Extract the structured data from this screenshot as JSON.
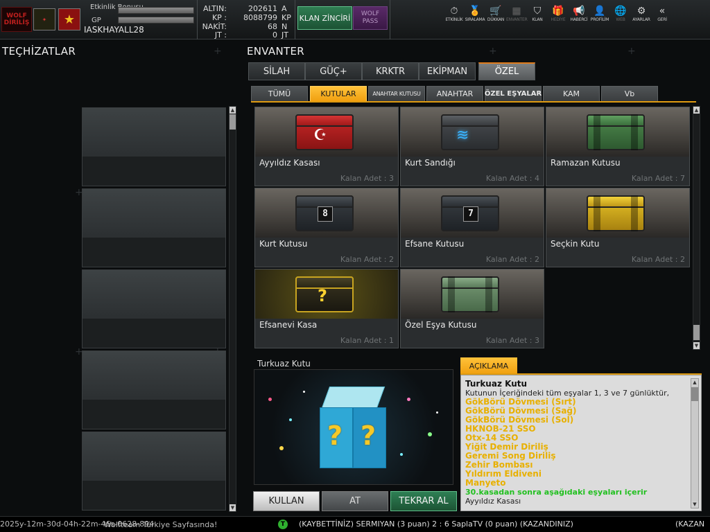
{
  "topbar": {
    "logo_text": "WOLF DİRİLİŞ",
    "event_bonus_label": "Etkinlik Bonusu",
    "gp_label": "GP",
    "username": "IASKHAYALL28",
    "currencies": [
      {
        "label": "ALTIN:",
        "value": "202611",
        "unit": "A"
      },
      {
        "label": "KP :",
        "value": "8088799",
        "unit": "KP"
      },
      {
        "label": "NAKİT:",
        "value": "68",
        "unit": "N"
      },
      {
        "label": "JT :",
        "value": "0",
        "unit": "JT"
      }
    ],
    "klan_button": "KLAN ZİNCİRİ",
    "wolf_pass": "WOLF PASS",
    "nav": [
      {
        "label": "ETKİNLİK",
        "icon": "stopwatch-icon",
        "glyph": "⏱"
      },
      {
        "label": "SIRALAMA",
        "icon": "medal-icon",
        "glyph": "🏅"
      },
      {
        "label": "DÜKKAN",
        "icon": "cart-icon",
        "glyph": "🛒"
      },
      {
        "label": "ENVANTER",
        "icon": "inventory-icon",
        "glyph": "▦"
      },
      {
        "label": "KLAN",
        "icon": "shield-icon",
        "glyph": "⛉"
      },
      {
        "label": "HEDİYE",
        "icon": "gift-icon",
        "glyph": "🎁"
      },
      {
        "label": "HABERCİ",
        "icon": "megaphone-icon",
        "glyph": "📢"
      },
      {
        "label": "PROFİLİM",
        "icon": "profile-icon",
        "glyph": "👤"
      },
      {
        "label": "WEB",
        "icon": "globe-icon",
        "glyph": "🌐"
      },
      {
        "label": "AYARLAR",
        "icon": "gear-icon",
        "glyph": "⚙"
      },
      {
        "label": "GERİ",
        "icon": "back-icon",
        "glyph": "«"
      }
    ]
  },
  "left": {
    "title": "TEÇHİZATLAR"
  },
  "inventory": {
    "title": "ENVANTER",
    "tabs": [
      "SİLAH",
      "GÜÇ+",
      "KRKTR",
      "EKİPMAN",
      "ÖZEL"
    ],
    "active_tab": 4,
    "subtabs": [
      "TÜMÜ",
      "KUTULAR",
      "ANAHTAR KUTUSU",
      "ANAHTAR",
      "ÖZEL EŞYALAR",
      "KAM",
      "Vb"
    ],
    "active_subtab": 1,
    "items": [
      {
        "name": "Ayyıldız Kasası",
        "count": "Kalan Adet : 3"
      },
      {
        "name": "Kurt Sandığı",
        "count": "Kalan Adet : 4"
      },
      {
        "name": "Ramazan Kutusu",
        "count": "Kalan Adet : 7"
      },
      {
        "name": "Kurt Kutusu",
        "count": "Kalan Adet : 2"
      },
      {
        "name": "Efsane Kutusu",
        "count": "Kalan Adet : 2"
      },
      {
        "name": "Seçkin Kutu",
        "count": "Kalan Adet : 2"
      },
      {
        "name": "Efsanevi Kasa",
        "count": "Kalan Adet : 1"
      },
      {
        "name": "Özel Eşya Kutusu",
        "count": "Kalan Adet : 3"
      }
    ],
    "box_numbers": {
      "kurt": "8",
      "efsane": "7",
      "efsanevi": "?"
    }
  },
  "preview": {
    "title": "Turkuaz Kutu",
    "glyph": "?"
  },
  "actions": {
    "use": "KULLAN",
    "drop": "AT",
    "rebuy": "TEKRAR AL"
  },
  "description": {
    "tab": "AÇIKLAMA",
    "title": "Turkuaz Kutu",
    "text": "Kutunun İçeriğindeki tüm eşyalar 1, 3 ve 7 günlüktür,",
    "items": [
      "GökBörü Dövmesi (Sırt)",
      "GökBörü Dövmesi (Sağ)",
      "GökBörü Dövmesi (Sol)",
      "HKNOB-21 SSO",
      "Otx-14 SSO",
      "Yiğit Demir Diriliş",
      "Geremi Song Diriliş",
      "Zehir Bombası",
      "Yıldırım Eldiveni",
      "Manyeto"
    ],
    "note": "30.kasadan sonra aşağıdaki eşyaları içerir",
    "extra": "Ayyıldız Kasası"
  },
  "ticker": {
    "left": "2025y-12m-30d-04h-22m-46s-0628-894",
    "sep": "Wolfteam Türkiye Sayfasında!",
    "icon": "T",
    "message": "(KAYBETTİNİZ) SERMIYAN (3 puan) 2 : 6 SaplaTV (0 puan) (KAZANDINIZ)",
    "far": "(KAZAN"
  }
}
